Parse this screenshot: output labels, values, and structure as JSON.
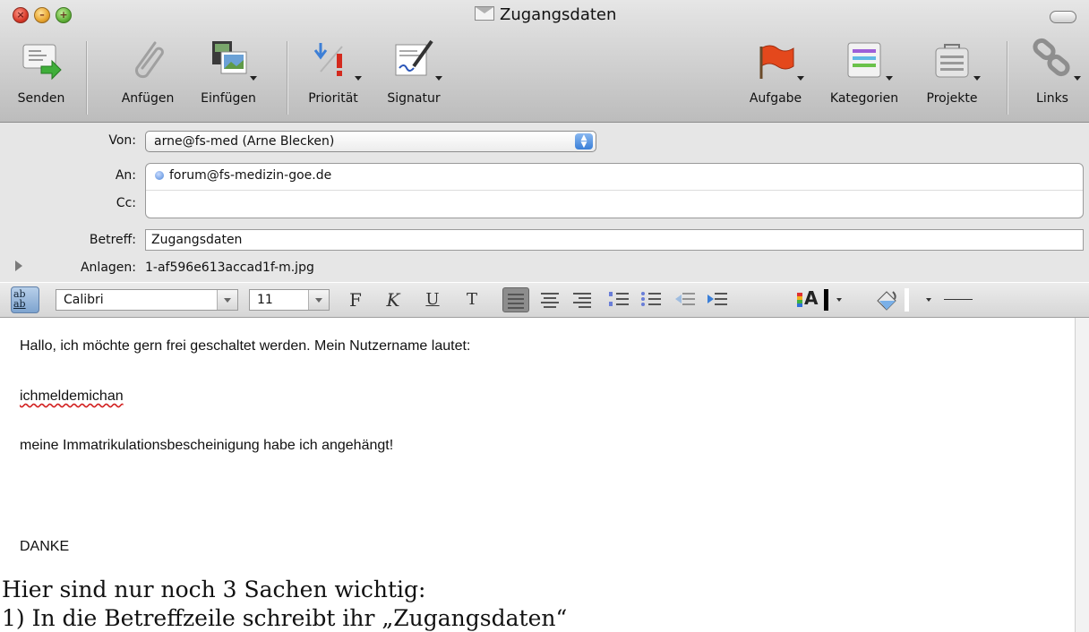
{
  "window": {
    "title": "Zugangsdaten"
  },
  "toolbar": {
    "items": [
      {
        "label": "Senden",
        "icon": "send-icon"
      },
      {
        "label": "Anfügen",
        "icon": "paperclip-icon"
      },
      {
        "label": "Einfügen",
        "icon": "insert-media-icon"
      },
      {
        "label": "Priorität",
        "icon": "priority-icon"
      },
      {
        "label": "Signatur",
        "icon": "signature-icon"
      },
      {
        "label": "Aufgabe",
        "icon": "flag-icon"
      },
      {
        "label": "Kategorien",
        "icon": "categories-icon"
      },
      {
        "label": "Projekte",
        "icon": "projects-icon"
      },
      {
        "label": "Links",
        "icon": "links-icon"
      }
    ]
  },
  "header": {
    "from_label": "Von:",
    "from_value": "arne@fs-med (Arne Blecken)",
    "to_label": "An:",
    "to_value": "forum@fs-medizin-goe.de",
    "cc_label": "Cc:",
    "subject_label": "Betreff:",
    "subject_value": "Zugangsdaten",
    "attachments_label": "Anlagen:",
    "attachments_value": "1-af596e613accad1f-m.jpg"
  },
  "format": {
    "font": "Calibri",
    "size": "11",
    "bold": "F",
    "italic": "K",
    "underline": "U",
    "strike": "T",
    "font_color_letter": "A"
  },
  "message": {
    "line1": "Hallo, ich möchte gern frei geschaltet werden. Mein Nutzername lautet:",
    "line2": "ichmeldemichan",
    "line3": "meine Immatrikulationsbescheinigung habe ich angehängt!",
    "line4": "DANKE"
  },
  "annotation": {
    "line1": "Hier sind nur noch 3 Sachen wichtig:",
    "line2": "1) In die Betreffzeile schreibt ihr „Zugangsdaten“"
  },
  "colors": {
    "accent": "#3a7fd8",
    "spellcheck": "#d22020"
  }
}
